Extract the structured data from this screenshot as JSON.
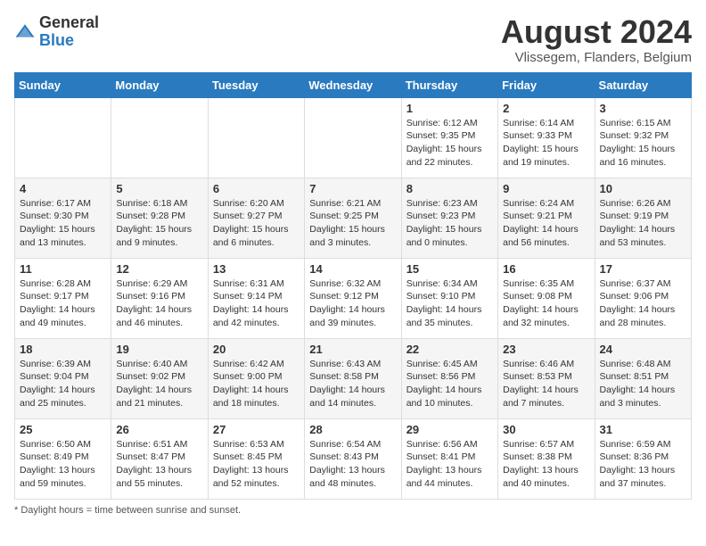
{
  "logo": {
    "general": "General",
    "blue": "Blue"
  },
  "title": {
    "month_year": "August 2024",
    "location": "Vlissegem, Flanders, Belgium"
  },
  "days_of_week": [
    "Sunday",
    "Monday",
    "Tuesday",
    "Wednesday",
    "Thursday",
    "Friday",
    "Saturday"
  ],
  "footer": {
    "note": "Daylight hours"
  },
  "weeks": [
    [
      {
        "day": "",
        "sunrise": "",
        "sunset": "",
        "daylight": ""
      },
      {
        "day": "",
        "sunrise": "",
        "sunset": "",
        "daylight": ""
      },
      {
        "day": "",
        "sunrise": "",
        "sunset": "",
        "daylight": ""
      },
      {
        "day": "",
        "sunrise": "",
        "sunset": "",
        "daylight": ""
      },
      {
        "day": "1",
        "sunrise": "Sunrise: 6:12 AM",
        "sunset": "Sunset: 9:35 PM",
        "daylight": "Daylight: 15 hours and 22 minutes."
      },
      {
        "day": "2",
        "sunrise": "Sunrise: 6:14 AM",
        "sunset": "Sunset: 9:33 PM",
        "daylight": "Daylight: 15 hours and 19 minutes."
      },
      {
        "day": "3",
        "sunrise": "Sunrise: 6:15 AM",
        "sunset": "Sunset: 9:32 PM",
        "daylight": "Daylight: 15 hours and 16 minutes."
      }
    ],
    [
      {
        "day": "4",
        "sunrise": "Sunrise: 6:17 AM",
        "sunset": "Sunset: 9:30 PM",
        "daylight": "Daylight: 15 hours and 13 minutes."
      },
      {
        "day": "5",
        "sunrise": "Sunrise: 6:18 AM",
        "sunset": "Sunset: 9:28 PM",
        "daylight": "Daylight: 15 hours and 9 minutes."
      },
      {
        "day": "6",
        "sunrise": "Sunrise: 6:20 AM",
        "sunset": "Sunset: 9:27 PM",
        "daylight": "Daylight: 15 hours and 6 minutes."
      },
      {
        "day": "7",
        "sunrise": "Sunrise: 6:21 AM",
        "sunset": "Sunset: 9:25 PM",
        "daylight": "Daylight: 15 hours and 3 minutes."
      },
      {
        "day": "8",
        "sunrise": "Sunrise: 6:23 AM",
        "sunset": "Sunset: 9:23 PM",
        "daylight": "Daylight: 15 hours and 0 minutes."
      },
      {
        "day": "9",
        "sunrise": "Sunrise: 6:24 AM",
        "sunset": "Sunset: 9:21 PM",
        "daylight": "Daylight: 14 hours and 56 minutes."
      },
      {
        "day": "10",
        "sunrise": "Sunrise: 6:26 AM",
        "sunset": "Sunset: 9:19 PM",
        "daylight": "Daylight: 14 hours and 53 minutes."
      }
    ],
    [
      {
        "day": "11",
        "sunrise": "Sunrise: 6:28 AM",
        "sunset": "Sunset: 9:17 PM",
        "daylight": "Daylight: 14 hours and 49 minutes."
      },
      {
        "day": "12",
        "sunrise": "Sunrise: 6:29 AM",
        "sunset": "Sunset: 9:16 PM",
        "daylight": "Daylight: 14 hours and 46 minutes."
      },
      {
        "day": "13",
        "sunrise": "Sunrise: 6:31 AM",
        "sunset": "Sunset: 9:14 PM",
        "daylight": "Daylight: 14 hours and 42 minutes."
      },
      {
        "day": "14",
        "sunrise": "Sunrise: 6:32 AM",
        "sunset": "Sunset: 9:12 PM",
        "daylight": "Daylight: 14 hours and 39 minutes."
      },
      {
        "day": "15",
        "sunrise": "Sunrise: 6:34 AM",
        "sunset": "Sunset: 9:10 PM",
        "daylight": "Daylight: 14 hours and 35 minutes."
      },
      {
        "day": "16",
        "sunrise": "Sunrise: 6:35 AM",
        "sunset": "Sunset: 9:08 PM",
        "daylight": "Daylight: 14 hours and 32 minutes."
      },
      {
        "day": "17",
        "sunrise": "Sunrise: 6:37 AM",
        "sunset": "Sunset: 9:06 PM",
        "daylight": "Daylight: 14 hours and 28 minutes."
      }
    ],
    [
      {
        "day": "18",
        "sunrise": "Sunrise: 6:39 AM",
        "sunset": "Sunset: 9:04 PM",
        "daylight": "Daylight: 14 hours and 25 minutes."
      },
      {
        "day": "19",
        "sunrise": "Sunrise: 6:40 AM",
        "sunset": "Sunset: 9:02 PM",
        "daylight": "Daylight: 14 hours and 21 minutes."
      },
      {
        "day": "20",
        "sunrise": "Sunrise: 6:42 AM",
        "sunset": "Sunset: 9:00 PM",
        "daylight": "Daylight: 14 hours and 18 minutes."
      },
      {
        "day": "21",
        "sunrise": "Sunrise: 6:43 AM",
        "sunset": "Sunset: 8:58 PM",
        "daylight": "Daylight: 14 hours and 14 minutes."
      },
      {
        "day": "22",
        "sunrise": "Sunrise: 6:45 AM",
        "sunset": "Sunset: 8:56 PM",
        "daylight": "Daylight: 14 hours and 10 minutes."
      },
      {
        "day": "23",
        "sunrise": "Sunrise: 6:46 AM",
        "sunset": "Sunset: 8:53 PM",
        "daylight": "Daylight: 14 hours and 7 minutes."
      },
      {
        "day": "24",
        "sunrise": "Sunrise: 6:48 AM",
        "sunset": "Sunset: 8:51 PM",
        "daylight": "Daylight: 14 hours and 3 minutes."
      }
    ],
    [
      {
        "day": "25",
        "sunrise": "Sunrise: 6:50 AM",
        "sunset": "Sunset: 8:49 PM",
        "daylight": "Daylight: 13 hours and 59 minutes."
      },
      {
        "day": "26",
        "sunrise": "Sunrise: 6:51 AM",
        "sunset": "Sunset: 8:47 PM",
        "daylight": "Daylight: 13 hours and 55 minutes."
      },
      {
        "day": "27",
        "sunrise": "Sunrise: 6:53 AM",
        "sunset": "Sunset: 8:45 PM",
        "daylight": "Daylight: 13 hours and 52 minutes."
      },
      {
        "day": "28",
        "sunrise": "Sunrise: 6:54 AM",
        "sunset": "Sunset: 8:43 PM",
        "daylight": "Daylight: 13 hours and 48 minutes."
      },
      {
        "day": "29",
        "sunrise": "Sunrise: 6:56 AM",
        "sunset": "Sunset: 8:41 PM",
        "daylight": "Daylight: 13 hours and 44 minutes."
      },
      {
        "day": "30",
        "sunrise": "Sunrise: 6:57 AM",
        "sunset": "Sunset: 8:38 PM",
        "daylight": "Daylight: 13 hours and 40 minutes."
      },
      {
        "day": "31",
        "sunrise": "Sunrise: 6:59 AM",
        "sunset": "Sunset: 8:36 PM",
        "daylight": "Daylight: 13 hours and 37 minutes."
      }
    ]
  ]
}
